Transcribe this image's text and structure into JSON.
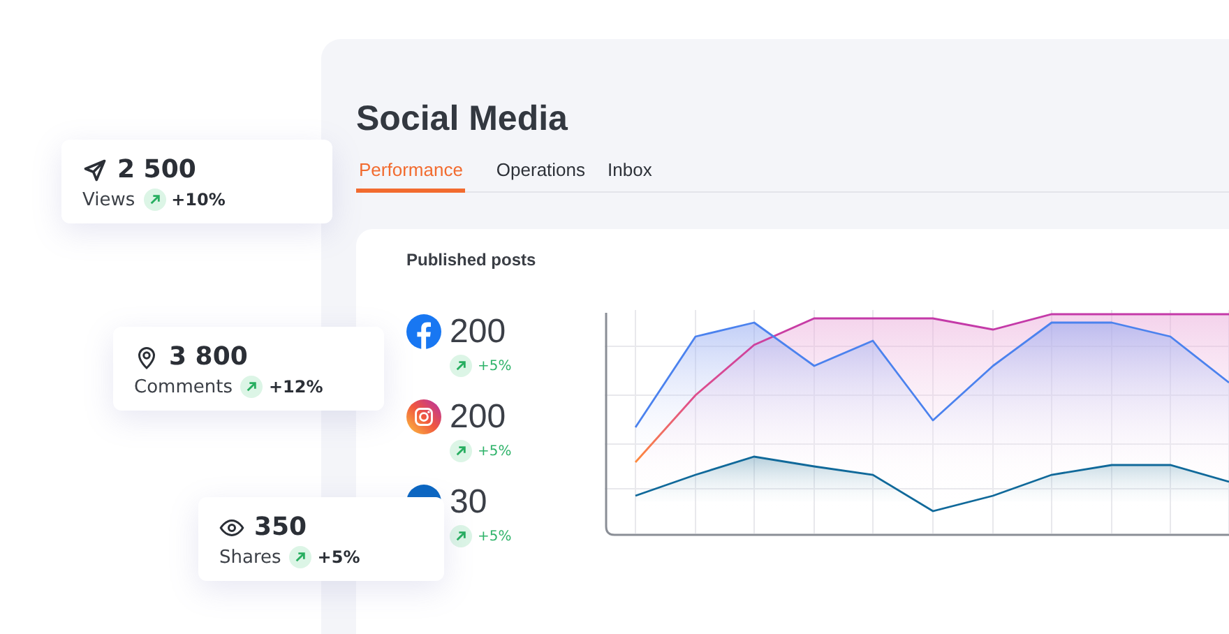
{
  "floating_stats": [
    {
      "kind": "send",
      "value": "2 500",
      "label": "Views",
      "change": "+10%"
    },
    {
      "kind": "pin",
      "value": "3 800",
      "label": "Comments",
      "change": "+12%"
    },
    {
      "kind": "eye",
      "value": "350",
      "label": "Shares",
      "change": "+5%"
    }
  ],
  "page": {
    "title": "Social Media"
  },
  "tabs": [
    {
      "label": "Performance",
      "selected": true
    },
    {
      "label": "Operations",
      "selected": false
    },
    {
      "label": "Inbox",
      "selected": false
    }
  ],
  "card": {
    "title": "Published posts",
    "platforms": [
      {
        "kind": "facebook",
        "value": "200",
        "change": "+5%"
      },
      {
        "kind": "instagram",
        "value": "200",
        "change": "+5%"
      },
      {
        "kind": "other",
        "value": "30",
        "change": "+5%"
      }
    ]
  }
}
